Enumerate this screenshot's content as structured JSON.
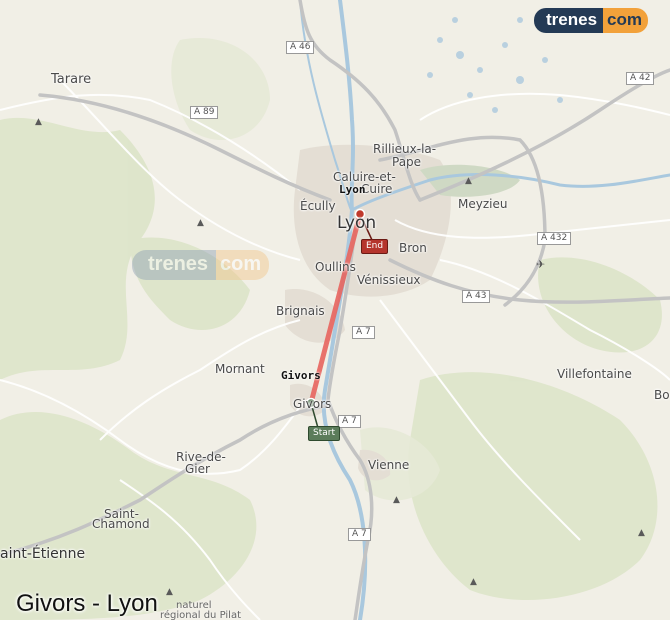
{
  "title": "Givors - Lyon",
  "brand": {
    "part1": "trenes",
    "part2": "com"
  },
  "route": {
    "origin_label": "Givors",
    "destination_label": "Lyon",
    "start_tag": "Start",
    "end_tag": "End",
    "line_color": "#e8655f"
  },
  "places": {
    "tarare": "Tarare",
    "rillieux": "Rillieux-la-",
    "rillieux2": "Pape",
    "caluire": "Caluire-et-",
    "caluire2": "Cuire",
    "ecully": "Écully",
    "lyon": "Lyon",
    "meyzieu": "Meyzieu",
    "bron": "Bron",
    "oullins": "Oullins",
    "venissieux": "Vénissieux",
    "brignais": "Brignais",
    "mornant": "Mornant",
    "givors": "Givors",
    "villefontaine": "Villefontaine",
    "bo": "Bo",
    "rive_de_gier": "Rive-de-",
    "rive_de_gier2": "Gier",
    "vienne": "Vienne",
    "saint_chamond": "Saint-",
    "saint_chamond2": "Chamond",
    "saint_etienne": "aint-Étienne",
    "pilat1": "naturel",
    "pilat2": "régional du Pilat"
  },
  "roads": {
    "a46": "A 46",
    "a42": "A 42",
    "a89": "A 89",
    "a432": "A 432",
    "a43": "A 43",
    "a7_north": "A 7",
    "a7_mid": "A 7",
    "a7_south": "A 7"
  },
  "colors": {
    "background": "#f1efe6",
    "forest": "#d6dfc0",
    "urban": "#e2ddd3",
    "water": "#a9c8de",
    "motorway": "#c9c9c9",
    "start_marker": "#5b7c5a",
    "end_marker": "#c0392b"
  }
}
